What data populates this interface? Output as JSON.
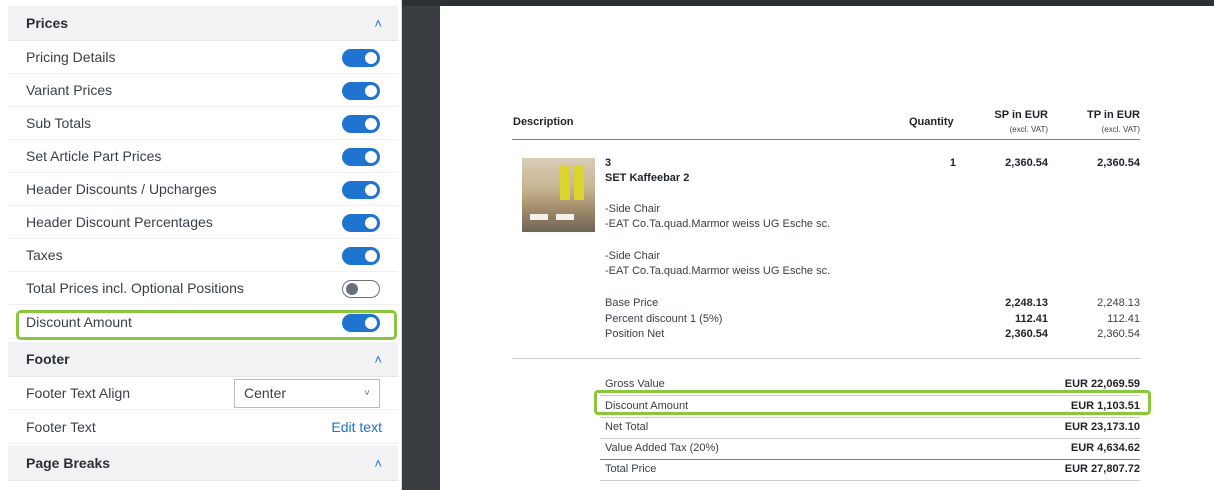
{
  "sidebar": {
    "prices_section": {
      "title": "Prices"
    },
    "price_toggles": [
      {
        "label": "Pricing Details",
        "on": true
      },
      {
        "label": "Variant Prices",
        "on": true
      },
      {
        "label": "Sub Totals",
        "on": true
      },
      {
        "label": "Set Article Part Prices",
        "on": true
      },
      {
        "label": "Header Discounts / Upcharges",
        "on": true
      },
      {
        "label": "Header Discount Percentages",
        "on": true
      },
      {
        "label": "Taxes",
        "on": true
      },
      {
        "label": "Total Prices incl. Optional Positions",
        "on": false
      },
      {
        "label": "Discount Amount",
        "on": true
      }
    ],
    "footer_section": {
      "title": "Footer"
    },
    "footer_text_align": {
      "label": "Footer Text Align",
      "value": "Center"
    },
    "footer_text": {
      "label": "Footer Text",
      "link": "Edit text"
    },
    "page_breaks_section": {
      "title": "Page Breaks"
    }
  },
  "document": {
    "headers": {
      "description": "Description",
      "quantity": "Quantity",
      "sp": "SP in EUR",
      "sp_sub": "(excl. VAT)",
      "tp": "TP in EUR",
      "tp_sub": "(excl. VAT)"
    },
    "position": {
      "number": "3",
      "name": "SET Kaffeebar 2",
      "quantity": "1",
      "sp": "2,360.54",
      "tp": "2,360.54",
      "parts": [
        {
          "line1": "-Side Chair",
          "line2": "-EAT Co.Ta.quad.Marmor weiss UG Esche sc."
        },
        {
          "line1": "-Side Chair",
          "line2": "-EAT Co.Ta.quad.Marmor weiss UG Esche sc."
        }
      ],
      "price_lines": [
        {
          "label": "Base Price",
          "sp": "2,248.13",
          "tp": "2,248.13"
        },
        {
          "label": "Percent discount 1 (5%)",
          "sp": "112.41",
          "tp": "112.41"
        },
        {
          "label": "Position Net",
          "sp": "2,360.54",
          "tp": "2,360.54"
        }
      ]
    },
    "totals": [
      {
        "label": "Gross Value",
        "value": "EUR 22,069.59"
      },
      {
        "label": "Discount Amount",
        "value": "EUR 1,103.51"
      },
      {
        "label": "Net Total",
        "value": "EUR 23,173.10"
      },
      {
        "label": "Value Added Tax (20%)",
        "value": "EUR 4,634.62"
      },
      {
        "label": "Total Price",
        "value": "EUR 27,807.72"
      }
    ]
  },
  "colors": {
    "accent": "#1e74d0",
    "highlight": "#8cc63f"
  },
  "icons": {
    "collapse": "chevron-up-icon",
    "dropdown": "chevron-down-icon"
  }
}
